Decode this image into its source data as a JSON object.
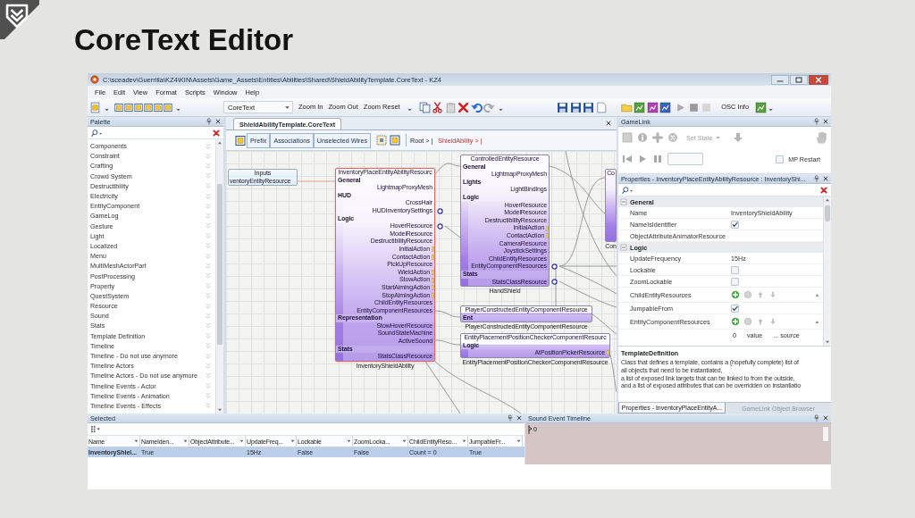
{
  "slide": {
    "title": "CoreText Editor"
  },
  "window": {
    "title": "C:\\sceadev\\Guerrilla\\KZ4\\KIN\\Assets\\Game_Assets\\Entities\\Abilities\\Shared\\ShieldAbilityTemplate.CoreText - KZ4",
    "menu": [
      "File",
      "Edit",
      "View",
      "Format",
      "Scripts",
      "Window",
      "Help"
    ]
  },
  "toolbar": {
    "dropdown": "CoreText",
    "zoom_buttons": [
      "Zoom In",
      "Zoom Out",
      "Zoom Reset"
    ],
    "osc_button": "OSC Info"
  },
  "palette": {
    "title": "Palette",
    "items": [
      "Components",
      "Constraint",
      "Crafting",
      "Crowd System",
      "Destructibility",
      "Electricity",
      "EntityComponent",
      "GameLog",
      "Gesture",
      "Light",
      "Localized",
      "Menu",
      "MultiMeshActorPart",
      "PostProcessing",
      "Property",
      "QuestSystem",
      "Resource",
      "Sound",
      "Stats",
      "Template Definition",
      "Timeline",
      "Timeline - Do not use anymore",
      "Timeline Actors",
      "Timeline Actors - Do not use anymore",
      "Timeline Events - Actor",
      "Timeline Events - Animation",
      "Timeline Events - Effects"
    ]
  },
  "document": {
    "tab": "ShieldAbilityTemplate.CoreText",
    "buttons": [
      "Prefix",
      "Associations",
      "Unselected Wires"
    ],
    "breadcrumb": [
      {
        "label": "Root > |",
        "selected": false
      },
      {
        "label": "ShieldAbility > |",
        "selected": true
      }
    ],
    "nodes": [
      {
        "kind": "input",
        "header": "Inputs",
        "selected": false,
        "rows": [
          {
            "label": "ventoryEntityResource",
            "kind": "field"
          }
        ]
      },
      {
        "kind": "entity",
        "header": "InventoryPlaceEntityAbilityResourc",
        "label": "InventoryShieldAbility",
        "selected": true,
        "rows": [
          {
            "label": "General",
            "kind": "section"
          },
          {
            "label": "LightmapProxyMesh",
            "kind": "field"
          },
          {
            "label": "HUD",
            "kind": "section"
          },
          {
            "label": "CrossHair",
            "kind": "field"
          },
          {
            "label": "HUDInventorySettings",
            "kind": "linked"
          },
          {
            "label": "Logic",
            "kind": "section"
          },
          {
            "label": "HoverResource",
            "kind": "linked"
          },
          {
            "label": "ModelResource",
            "kind": "field"
          },
          {
            "label": "DestructibilityResource",
            "kind": "field"
          },
          {
            "label": "InitialAction",
            "kind": "action"
          },
          {
            "label": "ContactAction",
            "kind": "action"
          },
          {
            "label": "PickUpResource",
            "kind": "field"
          },
          {
            "label": "WieldAction",
            "kind": "action"
          },
          {
            "label": "StowAction",
            "kind": "action"
          },
          {
            "label": "StartAimingAction",
            "kind": "action"
          },
          {
            "label": "StopAimingAction",
            "kind": "action"
          },
          {
            "label": "ChildEntityResources",
            "kind": "field"
          },
          {
            "label": "EntityComponentResources",
            "kind": "field"
          },
          {
            "label": "Representation",
            "kind": "section"
          },
          {
            "label": "StowHoverResource",
            "kind": "field"
          },
          {
            "label": "SoundStateMachine",
            "kind": "field"
          },
          {
            "label": "ActiveSound",
            "kind": "field"
          },
          {
            "label": "Stats",
            "kind": "section"
          },
          {
            "label": "StatsClassResource",
            "kind": "field"
          }
        ]
      },
      {
        "kind": "entity",
        "header": "ControlledEntityResource",
        "label": "HandShield",
        "selected": false,
        "rows": [
          {
            "label": "General",
            "kind": "section"
          },
          {
            "label": "LightmapProxyMesh",
            "kind": "field"
          },
          {
            "label": "Lights",
            "kind": "section"
          },
          {
            "label": "LightBindings",
            "kind": "field"
          },
          {
            "label": "Logic",
            "kind": "section"
          },
          {
            "label": "HoverResource",
            "kind": "field"
          },
          {
            "label": "ModelResource",
            "kind": "field"
          },
          {
            "label": "DestructibilityResource",
            "kind": "field"
          },
          {
            "label": "InitialAction",
            "kind": "action"
          },
          {
            "label": "ContactAction",
            "kind": "action"
          },
          {
            "label": "CameraResource",
            "kind": "field"
          },
          {
            "label": "JoystickSettings",
            "kind": "field"
          },
          {
            "label": "ChildEntityResources",
            "kind": "field"
          },
          {
            "label": "EntityComponentResources",
            "kind": "linked"
          },
          {
            "label": "Stats",
            "kind": "section"
          },
          {
            "label": "StatsClassResource",
            "kind": "linked"
          }
        ]
      },
      {
        "kind": "component",
        "header": "PlayerConstructedEntityComponentResource",
        "label": "PlayerConstructedEntityComponentResource",
        "selected": false,
        "rows": [
          {
            "label": "Ent",
            "kind": "section"
          }
        ]
      },
      {
        "kind": "component",
        "header": "EntityPlacementPositionCheckerComponentResourc",
        "label": "EntityPlacementPositionCheckerComponentResource",
        "selected": false,
        "rows": [
          {
            "label": "Logic",
            "kind": "section"
          },
          {
            "label": "AtPositionPickerResource",
            "kind": "action"
          }
        ]
      },
      {
        "kind": "entity",
        "header": "Co",
        "label": "Con",
        "selected": false
      }
    ]
  },
  "gamelink": {
    "title": "GameLink",
    "state_dropdown": "Set State",
    "mp_restart": {
      "label": "MP Restart",
      "checked": false
    }
  },
  "properties": {
    "title": "Properties - InventoryPlaceEntityAbilityResource : InventoryShi...",
    "sections": [
      {
        "title": "General",
        "expanded": true,
        "rows": [
          {
            "name": "Name",
            "kind": "text",
            "value": "InventoryShieldAbility"
          },
          {
            "name": "NameIsIdentifier",
            "kind": "check",
            "checked": true
          },
          {
            "name": "ObjectAttributeAnimatorResource",
            "kind": "empty"
          }
        ]
      },
      {
        "title": "Logic",
        "expanded": true,
        "rows": [
          {
            "name": "UpdateFrequency",
            "kind": "text",
            "value": "15Hz"
          },
          {
            "name": "Lockable",
            "kind": "check",
            "checked": false
          },
          {
            "name": "ZoomLockable",
            "kind": "check",
            "checked": false
          },
          {
            "name": "ChildEntityResources",
            "kind": "list"
          },
          {
            "name": "JumpableFrom",
            "kind": "check",
            "checked": true
          },
          {
            "name": "EntityComponentResources",
            "kind": "list",
            "sub_row": [
              "0",
              "value",
              "... source"
            ]
          }
        ]
      }
    ],
    "description": {
      "title": "TemplateDefinition",
      "text": "Class that defines a template, contains a (hopefully complete) list of\nall objects that need to be instantiated,\n a list of exposed link targets that can be linked to from the outside,\nand a list of exposed attributes that can be overridden on instantiatio"
    },
    "tabs": [
      {
        "label": "Properties - InventoryPlaceEntityA...",
        "selected": true
      },
      {
        "label": "GameLink Object Browser",
        "selected": false
      }
    ]
  },
  "selected_panel": {
    "title": "Selected",
    "columns": [
      "Name",
      "NameIden...",
      "ObjectAttribute...",
      "UpdateFreq...",
      "Lockable",
      "ZoomLocka...",
      "ChildEntityReso...",
      "JumpableFr..."
    ],
    "rows": [
      {
        "selected": true,
        "cells": [
          "InventoryShiel...",
          "True",
          null,
          "15Hz",
          "False",
          "False",
          "Count = 0",
          "True"
        ]
      }
    ]
  },
  "sound_timeline": {
    "title": "Sound Event Timeline",
    "start_time": "0"
  }
}
